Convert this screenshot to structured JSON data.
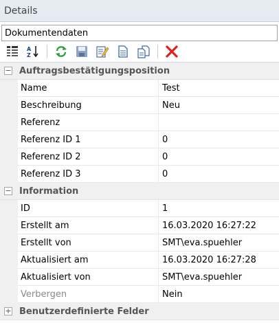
{
  "window": {
    "title": "Details"
  },
  "selector": {
    "value": "Dokumentendaten"
  },
  "toolbar": {
    "icons": [
      "categorized-view-icon",
      "alphabetical-sort-icon",
      "refresh-icon",
      "save-icon",
      "edit-icon",
      "new-document-icon",
      "copy-icon",
      "delete-icon"
    ]
  },
  "categories": [
    {
      "title": "Auftragsbestätigungsposition",
      "expanded": true,
      "props": [
        {
          "name": "Name",
          "value": "Test"
        },
        {
          "name": "Beschreibung",
          "value": "Neu"
        },
        {
          "name": "Referenz",
          "value": ""
        },
        {
          "name": "Referenz ID 1",
          "value": "0"
        },
        {
          "name": "Referenz ID 2",
          "value": "0"
        },
        {
          "name": "Referenz ID 3",
          "value": "0"
        }
      ]
    },
    {
      "title": "Information",
      "expanded": true,
      "props": [
        {
          "name": "ID",
          "value": "1"
        },
        {
          "name": "Erstellt am",
          "value": "16.03.2020 16:27:22"
        },
        {
          "name": "Erstellt von",
          "value": "SMT\\eva.spuehler"
        },
        {
          "name": "Aktualisiert am",
          "value": "16.03.2020 16:27:28"
        },
        {
          "name": "Aktualisiert von",
          "value": "SMT\\eva.spuehler"
        },
        {
          "name": "Verbergen",
          "value": "Nein",
          "muted": true
        }
      ]
    },
    {
      "title": "Benutzerdefinierte Felder",
      "expanded": false,
      "props": []
    }
  ]
}
